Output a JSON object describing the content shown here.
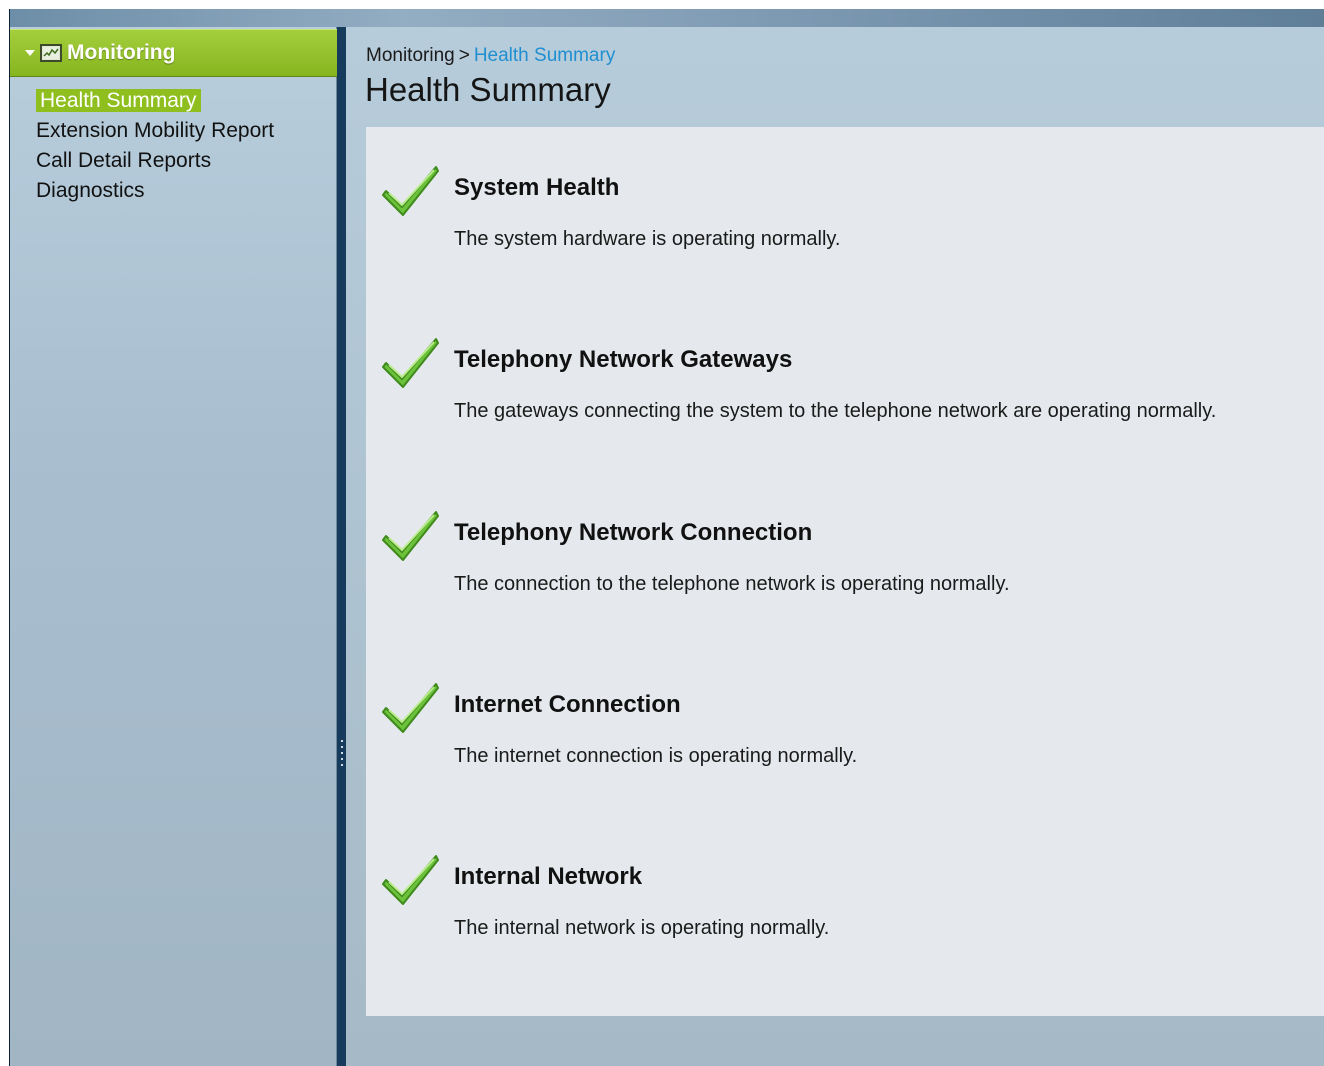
{
  "sidebar": {
    "section_title": "Monitoring",
    "items": [
      {
        "label": "Health Summary",
        "selected": true
      },
      {
        "label": "Extension Mobility Report",
        "selected": false
      },
      {
        "label": "Call Detail Reports",
        "selected": false
      },
      {
        "label": "Diagnostics",
        "selected": false
      }
    ]
  },
  "breadcrumb": {
    "root": "Monitoring",
    "separator": ">",
    "current": "Health Summary"
  },
  "page_title": "Health Summary",
  "health_items": [
    {
      "title": "System Health",
      "description": "The system hardware is operating normally.",
      "status_icon": "check-icon"
    },
    {
      "title": "Telephony Network Gateways",
      "description": "The gateways connecting the system to the telephone network are operating normally.",
      "status_icon": "check-icon"
    },
    {
      "title": "Telephony Network Connection",
      "description": "The connection to the telephone network is operating normally.",
      "status_icon": "check-icon"
    },
    {
      "title": "Internet Connection",
      "description": "The internet connection is operating normally.",
      "status_icon": "check-icon"
    },
    {
      "title": "Internal Network",
      "description": "The internal network is operating normally.",
      "status_icon": "check-icon"
    }
  ],
  "colors": {
    "accent_green": "#8fbf1f",
    "breadcrumb_link": "#1f8fd0",
    "check_green": "#6cc23a"
  }
}
